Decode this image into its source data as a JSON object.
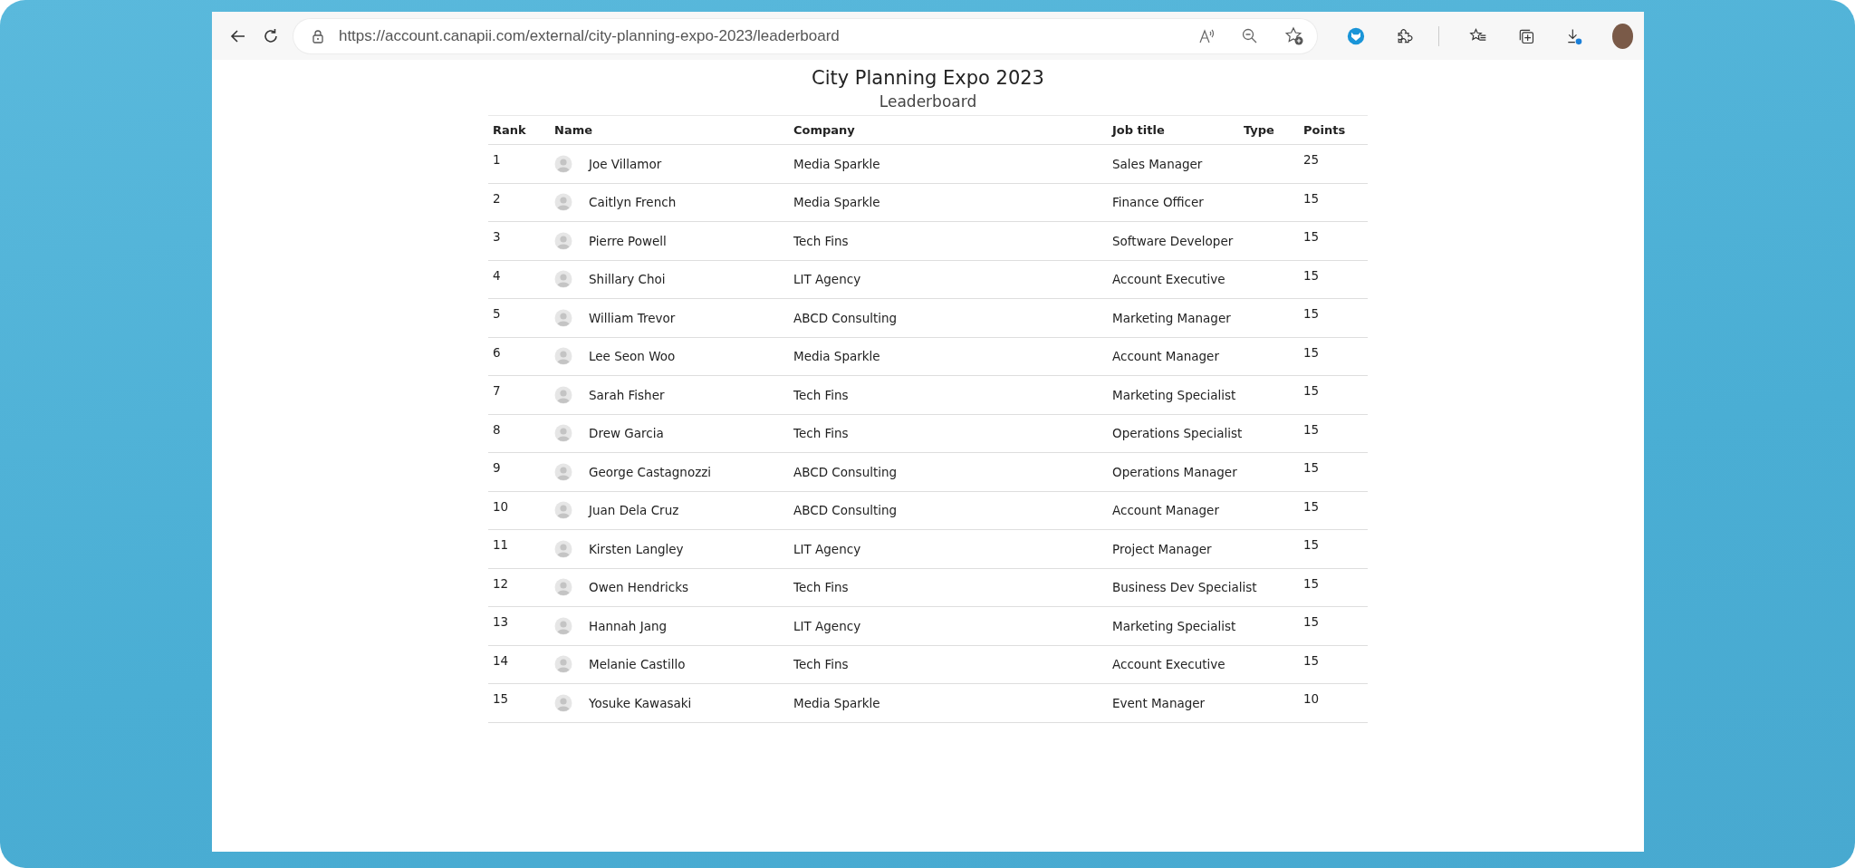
{
  "browser": {
    "url": "https://account.canapii.com/external/city-planning-expo-2023/leaderboard"
  },
  "page": {
    "title": "City Planning Expo 2023",
    "subtitle": "Leaderboard"
  },
  "table": {
    "columns": [
      "Rank",
      "Name",
      "Company",
      "Job title",
      "Type",
      "Points"
    ],
    "rows": [
      {
        "rank": "1",
        "name": "Joe Villamor",
        "company": "Media Sparkle",
        "job_title": "Sales Manager",
        "points": "25"
      },
      {
        "rank": "2",
        "name": "Caitlyn French",
        "company": "Media Sparkle",
        "job_title": "Finance Officer",
        "points": "15"
      },
      {
        "rank": "3",
        "name": "Pierre Powell",
        "company": "Tech Fins",
        "job_title": "Software Developer",
        "points": "15"
      },
      {
        "rank": "4",
        "name": "Shillary Choi",
        "company": "LIT Agency",
        "job_title": "Account Executive",
        "points": "15"
      },
      {
        "rank": "5",
        "name": "William Trevor",
        "company": "ABCD Consulting",
        "job_title": "Marketing Manager",
        "points": "15"
      },
      {
        "rank": "6",
        "name": "Lee Seon Woo",
        "company": "Media Sparkle",
        "job_title": "Account Manager",
        "points": "15"
      },
      {
        "rank": "7",
        "name": "Sarah Fisher",
        "company": "Tech Fins",
        "job_title": "Marketing Specialist",
        "points": "15"
      },
      {
        "rank": "8",
        "name": "Drew Garcia",
        "company": "Tech Fins",
        "job_title": "Operations Specialist",
        "points": "15"
      },
      {
        "rank": "9",
        "name": "George Castagnozzi",
        "company": "ABCD Consulting",
        "job_title": "Operations Manager",
        "points": "15"
      },
      {
        "rank": "10",
        "name": "Juan Dela Cruz",
        "company": "ABCD Consulting",
        "job_title": "Account Manager",
        "points": "15"
      },
      {
        "rank": "11",
        "name": "Kirsten Langley",
        "company": "LIT Agency",
        "job_title": "Project Manager",
        "points": "15"
      },
      {
        "rank": "12",
        "name": "Owen Hendricks",
        "company": "Tech Fins",
        "job_title": "Business Dev Specialist",
        "points": "15"
      },
      {
        "rank": "13",
        "name": "Hannah Jang",
        "company": "LIT Agency",
        "job_title": "Marketing Specialist",
        "points": "15"
      },
      {
        "rank": "14",
        "name": "Melanie Castillo",
        "company": "Tech Fins",
        "job_title": "Account Executive",
        "points": "15"
      },
      {
        "rank": "15",
        "name": "Yosuke Kawasaki",
        "company": "Media Sparkle",
        "job_title": "Event Manager",
        "points": "10"
      }
    ]
  }
}
